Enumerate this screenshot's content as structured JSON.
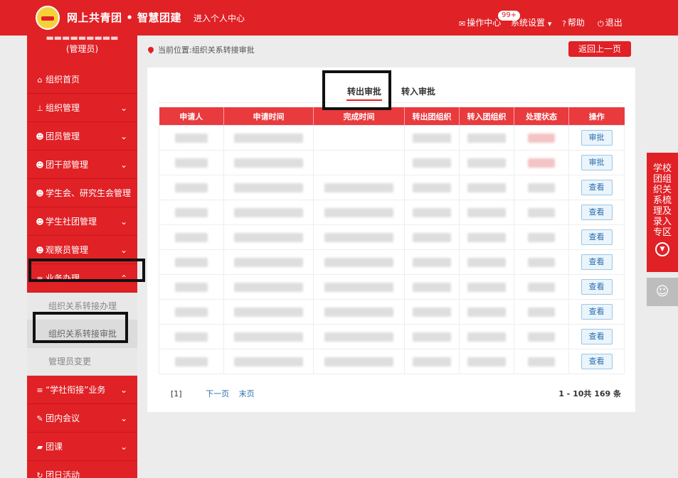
{
  "header": {
    "brand": "网上共青团 • 智慧团建",
    "personal_center": "进入个人中心",
    "nav": [
      {
        "label": "操作中心",
        "icon": "mail-icon"
      },
      {
        "label": "系统设置",
        "icon": "chevron-down-icon"
      },
      {
        "label": "帮助",
        "icon": "help-icon"
      },
      {
        "label": "退出",
        "icon": "power-icon"
      }
    ],
    "badge": "99+"
  },
  "sidebar": {
    "role": "(管理员)",
    "items": [
      {
        "label": "组织首页",
        "icon": "home-icon"
      },
      {
        "label": "组织管理",
        "icon": "org-chart-icon"
      },
      {
        "label": "团员管理",
        "icon": "users-icon"
      },
      {
        "label": "团干部管理",
        "icon": "users-icon"
      },
      {
        "label": "学生会、研究生会管理",
        "icon": "users-icon"
      },
      {
        "label": "学生社团管理",
        "icon": "users-icon"
      },
      {
        "label": "观察员管理",
        "icon": "users-icon"
      },
      {
        "label": "业务办理",
        "icon": "list-icon"
      },
      {
        "label": "“学社衔接”业务",
        "icon": "list-icon"
      },
      {
        "label": "团内会议",
        "icon": "edit-icon"
      },
      {
        "label": "团课",
        "icon": "folder-icon"
      },
      {
        "label": "团日活动",
        "icon": "refresh-icon"
      }
    ],
    "sub_items": [
      "组织关系转接办理",
      "组织关系转接审批",
      "管理员变更"
    ]
  },
  "breadcrumb": {
    "text": "当前位置:组织关系转接审批"
  },
  "back_button": "返回上一页",
  "tabs": [
    "转出审批",
    "转入审批"
  ],
  "table": {
    "headers": [
      "申请人",
      "申请时间",
      "完成时间",
      "转出团组织",
      "转入团组织",
      "处理状态",
      "操作"
    ],
    "rows": [
      {
        "action": "审批"
      },
      {
        "action": "审批"
      },
      {
        "action": "查看"
      },
      {
        "action": "查看"
      },
      {
        "action": "查看"
      },
      {
        "action": "查看"
      },
      {
        "action": "查看"
      },
      {
        "action": "查看"
      },
      {
        "action": "查看"
      },
      {
        "action": "查看"
      }
    ]
  },
  "pagination": {
    "current": "[1]",
    "next": "下一页",
    "last": "末页",
    "summary": "1 - 10共 169 条"
  },
  "float_panel": {
    "text": "学校团组织关系梳理及录入专区"
  },
  "colors": {
    "primary_red": "#e02126",
    "header_cell": "#e93a3e",
    "link_blue": "#2a6fb0"
  }
}
